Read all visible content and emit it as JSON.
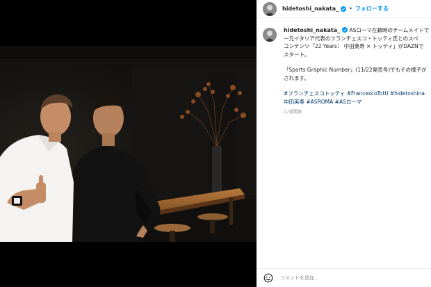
{
  "post": {
    "username": "hidetoshi_nakata_",
    "separator": "•",
    "follow_label": "フォローする",
    "photo_alt": "Two men posing together in a dark room with a wooden table and a vase of branches"
  },
  "caption": {
    "username": "hidetoshi_nakata_",
    "line1": "ASローマ在籍時のチームメイトで",
    "line2": "一元イタリア代表のフランチェスコ・トッティ氏とのスペ",
    "line3": "コンテンツ「22 Years： 中田英寿 × トッティ」がDAZNで",
    "line4": "スタート。",
    "line5": "「Sports Graphic Number」(11/22発売号)でもその様子が",
    "line6": "されます。",
    "tags1": "#フランチェスコトッティ #FrancescoTotti #hidetoshina",
    "tags2": "中田英寿 #ASROMA #ASローマ",
    "time": "17週間前"
  },
  "comment": {
    "placeholder": "コメントを追加..."
  },
  "colors": {
    "follow": "#0095f6",
    "verified": "#0095f6",
    "hashtag": "#00376b",
    "timestamp": "#8e8e8e"
  },
  "icons": [
    "verified-badge-icon",
    "emoji-icon"
  ]
}
